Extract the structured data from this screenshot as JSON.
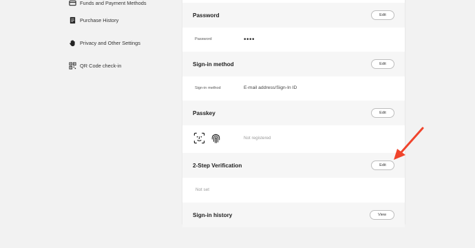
{
  "sidebar": {
    "items": [
      {
        "label": "Funds and Payment Methods",
        "icon": "credit-card-icon"
      },
      {
        "label": "Purchase History",
        "icon": "receipt-icon"
      },
      {
        "label": "Privacy and Other Settings",
        "icon": "hand-icon"
      },
      {
        "label": "QR Code check-in",
        "icon": "qr-code-icon"
      }
    ]
  },
  "sections": {
    "password": {
      "title": "Password",
      "button": "Edit",
      "row_label": "Password",
      "row_value": "••••"
    },
    "signin_method": {
      "title": "Sign-in method",
      "button": "Edit",
      "row_label": "Sign-in method",
      "row_value": "E-mail address/Sign-In ID"
    },
    "passkey": {
      "title": "Passkey",
      "button": "Edit",
      "status": "Not registered",
      "icons": [
        "face-id-icon",
        "fingerprint-icon"
      ]
    },
    "two_step": {
      "title": "2-Step Verification",
      "button": "Edit",
      "status": "Not set"
    },
    "signin_history": {
      "title": "Sign-in history",
      "button": "View"
    }
  },
  "annotation": {
    "arrow_color": "#f0442c",
    "target": "2-Step Verification edit button"
  }
}
